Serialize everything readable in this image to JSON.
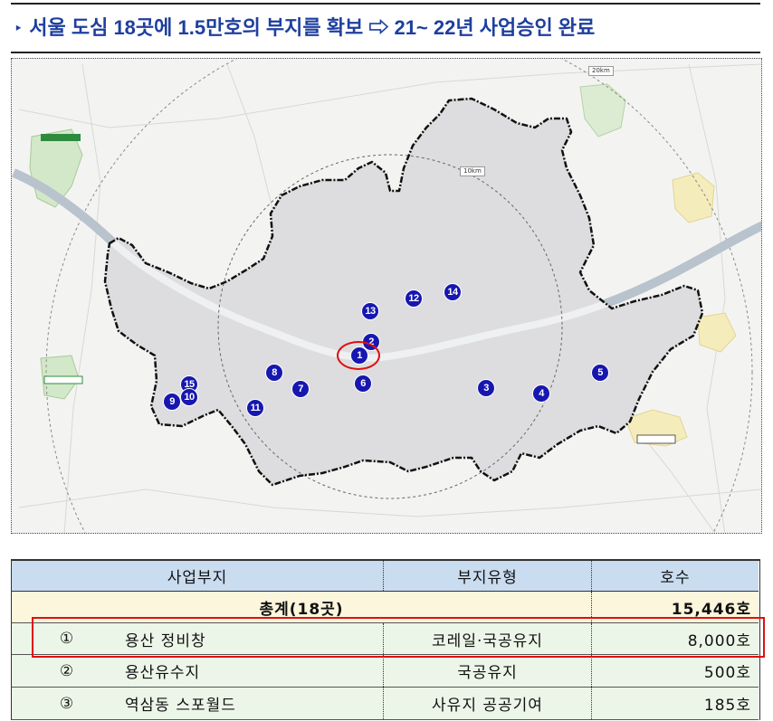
{
  "title": {
    "bullet": "‣",
    "text": "서울 도심 18곳에 1.5만호의 부지를 확보 ⇨ 21~ 22년 사업승인 완료"
  },
  "map": {
    "scale_labels": {
      "outer": "20km",
      "inner": "10km"
    },
    "markers": [
      {
        "label": "1",
        "highlighted": true
      },
      {
        "label": "2"
      },
      {
        "label": "3"
      },
      {
        "label": "4"
      },
      {
        "label": "5"
      },
      {
        "label": "6"
      },
      {
        "label": "7"
      },
      {
        "label": "8"
      },
      {
        "label": "9"
      },
      {
        "label": "10"
      },
      {
        "label": "11"
      },
      {
        "label": "12"
      },
      {
        "label": "13"
      },
      {
        "label": "14"
      },
      {
        "label": "15"
      }
    ]
  },
  "table": {
    "headers": [
      "사업부지",
      "부지유형",
      "호수"
    ],
    "total": {
      "label": "총계(18곳)",
      "units": "15,446호"
    },
    "rows": [
      {
        "no": "①",
        "site": "용산 정비창",
        "type": "코레일·국공유지",
        "units": "8,000호",
        "highlighted": true
      },
      {
        "no": "②",
        "site": "용산유수지",
        "type": "국공유지",
        "units": "500호"
      },
      {
        "no": "③",
        "site": "역삼동 스포월드",
        "type": "사유지 공공기여",
        "units": "185호"
      }
    ]
  },
  "colors": {
    "title": "#1e3f9e",
    "marker": "#1717b0",
    "highlight": "#e01010",
    "header_bg": "#c9dcf0",
    "total_bg": "#fcf6dc",
    "row_bg": "#ecf6e8"
  }
}
